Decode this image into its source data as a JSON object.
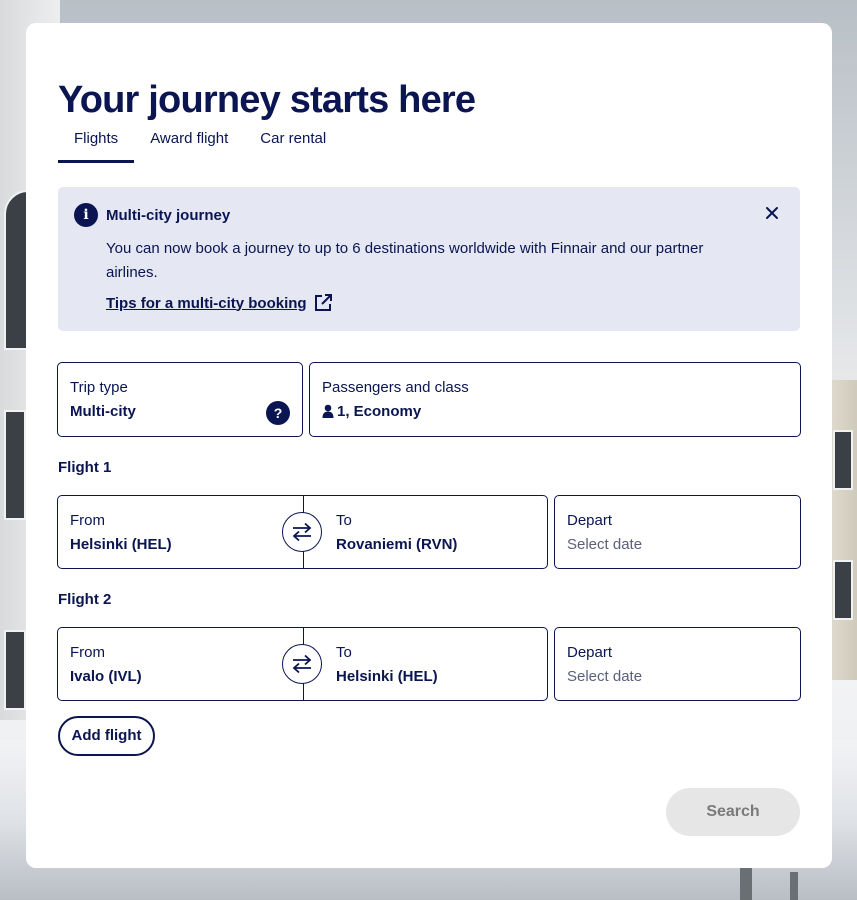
{
  "page": {
    "title": "Your journey starts here"
  },
  "tabs": [
    {
      "label": "Flights",
      "active": true
    },
    {
      "label": "Award flight",
      "active": false
    },
    {
      "label": "Car rental",
      "active": false
    }
  ],
  "notice": {
    "icon": "info-icon",
    "title": "Multi-city journey",
    "body": "You can now book a journey to up to 6 destinations worldwide with Finnair and our partner airlines.",
    "link_label": "Tips for a multi-city booking",
    "link_icon": "external-link-icon",
    "close_icon": "close-icon"
  },
  "trip_type": {
    "label": "Trip type",
    "value": "Multi-city",
    "help_icon": "?"
  },
  "passengers": {
    "label": "Passengers and class",
    "value": "1, Economy",
    "icon": "person-icon"
  },
  "flights": [
    {
      "heading": "Flight 1",
      "from_label": "From",
      "from_value": "Helsinki (HEL)",
      "to_label": "To",
      "to_value": "Rovaniemi (RVN)",
      "depart_label": "Depart",
      "depart_placeholder": "Select date"
    },
    {
      "heading": "Flight 2",
      "from_label": "From",
      "from_value": "Ivalo (IVL)",
      "to_label": "To",
      "to_value": "Helsinki (HEL)",
      "depart_label": "Depart",
      "depart_placeholder": "Select date"
    }
  ],
  "buttons": {
    "add_flight": "Add flight",
    "search": "Search"
  },
  "colors": {
    "primary": "#0a1551",
    "notice_bg": "#e5e7f3",
    "disabled_bg": "#e6e6e6",
    "disabled_text": "#7a7a7a"
  }
}
